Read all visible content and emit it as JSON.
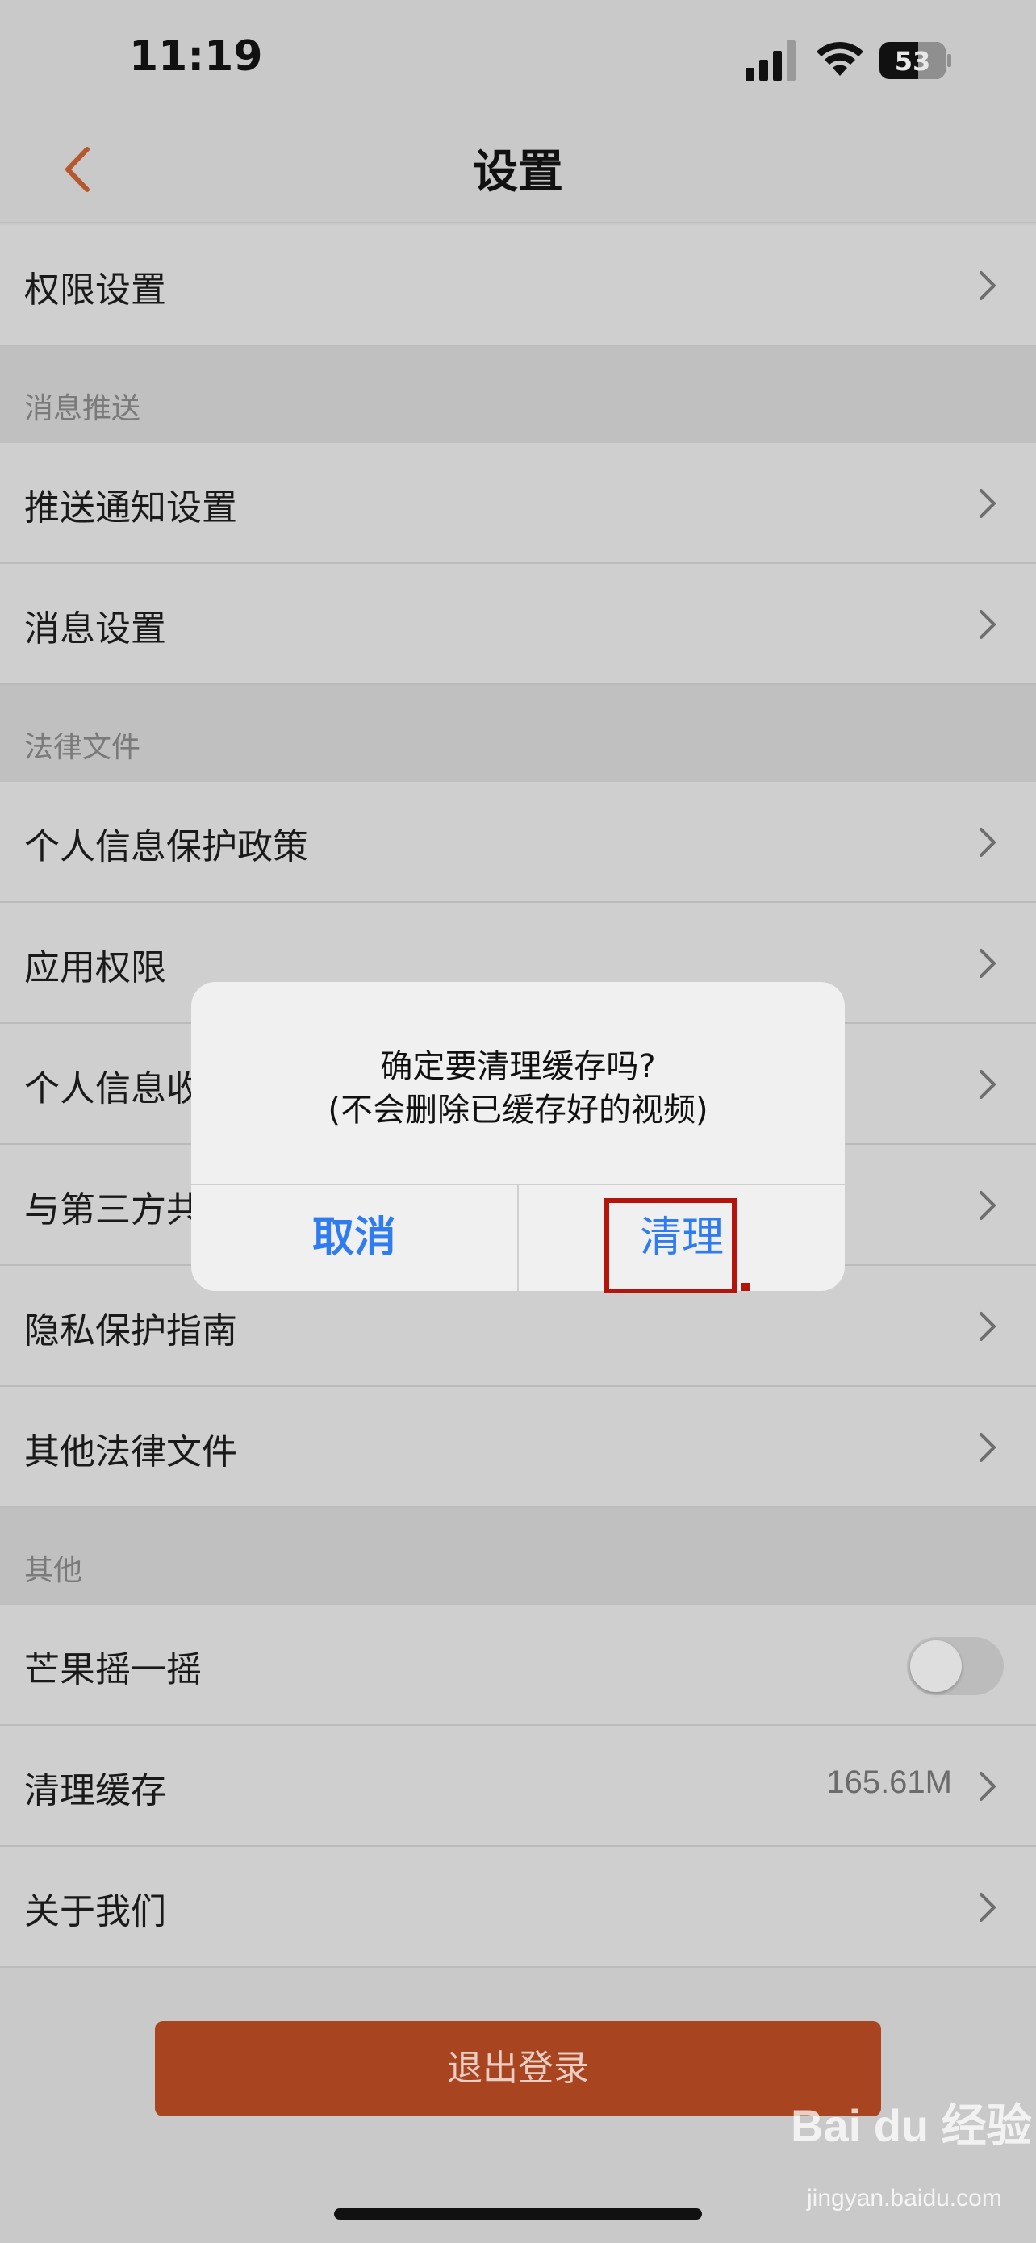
{
  "status_bar": {
    "time": "11:19",
    "battery": "53"
  },
  "nav": {
    "title": "设置"
  },
  "rows_top": [
    {
      "label": "权限设置"
    }
  ],
  "sections": [
    {
      "title": "消息推送"
    },
    {
      "title": "法律文件"
    },
    {
      "title": "其他"
    }
  ],
  "push_rows": [
    {
      "label": "推送通知设置"
    },
    {
      "label": "消息设置"
    }
  ],
  "legal_rows": [
    {
      "label": "个人信息保护政策"
    },
    {
      "label": "应用权限"
    },
    {
      "label": "个人信息收"
    },
    {
      "label": "与第三方共"
    },
    {
      "label": "隐私保护指南"
    },
    {
      "label": "其他法律文件"
    }
  ],
  "other_rows": [
    {
      "label": "芒果摇一摇",
      "toggle_on": false
    },
    {
      "label": "清理缓存",
      "value": "165.61M"
    },
    {
      "label": "关于我们"
    }
  ],
  "logout_label": "退出登录",
  "dialog": {
    "line1": "确定要清理缓存吗?",
    "line2": "(不会删除已缓存好的视频)",
    "cancel": "取消",
    "confirm": "清理"
  },
  "watermark": {
    "main": "Bai du 经验",
    "sub": "jingyan.baidu.com"
  },
  "colors": {
    "accent": "#a8441f",
    "dialog_button": "#2f7bf0",
    "highlight": "#b3140c"
  }
}
